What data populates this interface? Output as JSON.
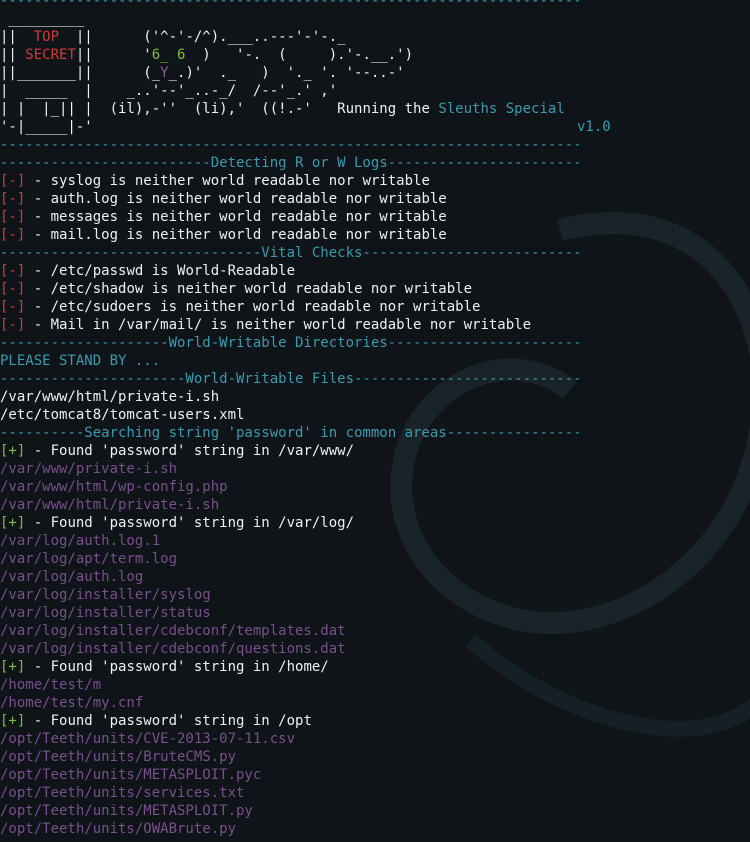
{
  "colors": {
    "background": "#0e1417",
    "accent": "#3a9bb0",
    "error": "#d23a3a",
    "ok": "#7fbf3a",
    "path": "#7a4f8e",
    "text": "#f0f0f0"
  },
  "banner": {
    "rule_top": "---------------------------------------------------------------------",
    "l1": " _________",
    "l2a": "||  ",
    "l2b": "TOP",
    "l2c": "  ||      ('^-'-/^).___..---'-'-._",
    "l3a": "|| ",
    "l3b": "SECRET",
    "l3c": "||      '",
    "l3d": "6_ 6",
    "l3e": "  )   '-.  (     ).'-.__.')",
    "l4a": "||_______||      (_",
    "l4b": "Y",
    "l4c": "_.)'  ._   )  '._ '. '--..-'",
    "l5": "|  _____  |    _..'--'_..-_/  /--'_.' ,'",
    "l6a": "| |  |_|| |  (il),-''  (li),'  ((!.-'   ",
    "l6b": "Running the ",
    "l6c": "Sleuths Special",
    "version": "v1.0",
    "l7": "'-|_____|-'",
    "rule_mid": "---------------------------------------------------------------------"
  },
  "sections": {
    "logs": {
      "header": "-------------------------Detecting R or W Logs-----------------------",
      "items": [
        {
          "tag": "[-]",
          "text": " - syslog is neither world readable nor writable"
        },
        {
          "tag": "[-]",
          "text": " - auth.log is neither world readable nor writable"
        },
        {
          "tag": "[-]",
          "text": " - messages is neither world readable nor writable"
        },
        {
          "tag": "[-]",
          "text": " - mail.log is neither world readable nor writable"
        }
      ]
    },
    "vital": {
      "header": "-------------------------------Vital Checks--------------------------",
      "items": [
        {
          "tag": "[-]",
          "text": " - /etc/passwd is World-Readable"
        },
        {
          "tag": "[-]",
          "text": " - /etc/shadow is neither world readable nor writable"
        },
        {
          "tag": "[-]",
          "text": " - /etc/sudoers is neither world readable nor writable"
        },
        {
          "tag": "[-]",
          "text": " - Mail in /var/mail/ is neither world readable nor writable"
        }
      ]
    },
    "wwdirs": {
      "header": "--------------------World-Writable Directories-----------------------",
      "status": "PLEASE STAND BY ..."
    },
    "wwfiles": {
      "header": "----------------------World-Writable Files---------------------------",
      "files": [
        "/var/www/html/private-i.sh",
        "/etc/tomcat8/tomcat-users.xml"
      ]
    },
    "search": {
      "header": "----------Searching string 'password' in common areas----------------",
      "groups": [
        {
          "tag": "[+]",
          "text": " - Found 'password' string in /var/www/",
          "paths": [
            "/var/www/private-i.sh",
            "/var/www/html/wp-config.php",
            "/var/www/html/private-i.sh"
          ]
        },
        {
          "tag": "[+]",
          "text": " - Found 'password' string in /var/log/",
          "paths": [
            "/var/log/auth.log.1",
            "/var/log/apt/term.log",
            "/var/log/auth.log",
            "/var/log/installer/syslog",
            "/var/log/installer/status",
            "/var/log/installer/cdebconf/templates.dat",
            "/var/log/installer/cdebconf/questions.dat"
          ]
        },
        {
          "tag": "[+]",
          "text": " - Found 'password' string in /home/",
          "paths": [
            "/home/test/m",
            "/home/test/my.cnf"
          ]
        },
        {
          "tag": "[+]",
          "text": " - Found 'password' string in /opt",
          "paths": [
            "/opt/Teeth/units/CVE-2013-07-11.csv",
            "/opt/Teeth/units/BruteCMS.py",
            "/opt/Teeth/units/METASPLOIT.pyc",
            "/opt/Teeth/units/services.txt",
            "/opt/Teeth/units/METASPLOIT.py",
            "/opt/Teeth/units/OWABrute.py"
          ]
        }
      ]
    }
  }
}
